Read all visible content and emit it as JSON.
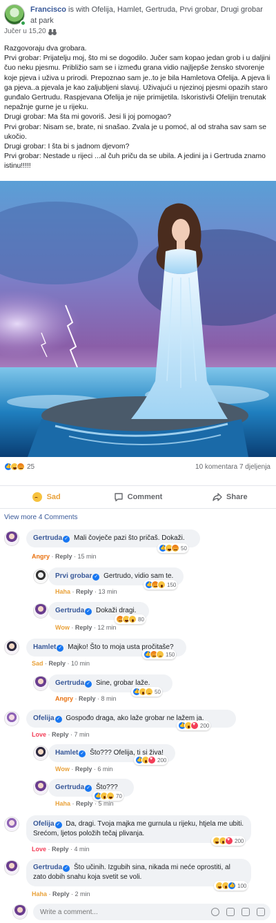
{
  "header": {
    "author": "Francisco",
    "with_text": "is with Ofelija, Hamlet, Gertruda, Prvi grobar, Drugi grobar at park",
    "time": "Jučer u 15,20",
    "audience_icon": "friends-icon"
  },
  "post": {
    "text": "Razgovoraju dva grobara.\nPrvi grobar: Prijatelju moj, što mi se dogodilo. Jučer sam kopao jedan grob i u daljini čuo neku pjesmu. Približio sam se i između grana vidio najljepše žensko stvorenje koje pjeva i uživa u prirodi. Prepoznao sam je..to je bila Hamletova Ofelija. A pjeva li ga pjeva..a pjevala je kao zaljubljeni slavuj. Uživajući u njezinoj pjesmi opazih staro gunđalo Gertrudu. Raspjevana Ofelija je nije primijetila. Iskoristivši Ofelijin trenutak nepažnje gurne je u rijeku.\nDrugi grobar: Ma šta mi govoriš. Jesi li joj pomogao?\nPrvi grobar: Nisam se, brate, ni snašao. Zvala je u pomoć, al od straha sav sam se ukočio.\nDrugi grobar: I šta bi s jadnom djevom?\nPrvi grobar: Nestade u rijeci ...al čuh priču da se ubila. A jedini ja i Gertruda znamo istinu!!!!!"
  },
  "stats": {
    "reactions": [
      "like",
      "haha",
      "angry"
    ],
    "count": "25",
    "comments_shares": "10 komentara 7 djeljenja"
  },
  "actions": {
    "sad": "Sad",
    "comment": "Comment",
    "share": "Share"
  },
  "view_more": "View more 4 Comments",
  "reply_label": "Reply",
  "comments": [
    {
      "name": "Gertruda",
      "text": "Mali čovječe pazi što pričaš. Dokaži.",
      "reaction": "Angry",
      "time": "15 min",
      "react_count": "50",
      "avatar": "gertruda"
    },
    {
      "name": "Prvi grobar",
      "text": "Gertrudo, vidio sam te.",
      "reaction": "Haha",
      "time": "13 min",
      "react_count": "150",
      "avatar": "prvi"
    },
    {
      "name": "Gertruda",
      "text": "Dokaži dragi.",
      "reaction": "Wow",
      "time": "12 min",
      "react_count": "80",
      "avatar": "gertruda"
    },
    {
      "name": "Hamlet",
      "text": "Majko! Što to moja usta pročitaše?",
      "reaction": "Sad",
      "time": "10 min",
      "react_count": "150",
      "avatar": "hamlet"
    },
    {
      "name": "Gertruda",
      "text": "Sine, grobar laže.",
      "reaction": "Angry",
      "time": "8 min",
      "react_count": "50",
      "avatar": "gertruda"
    },
    {
      "name": "Ofelija",
      "text": "Gospođo draga, ako laže grobar ne lažem ja.",
      "reaction": "Love",
      "time": "7 min",
      "react_count": "200",
      "avatar": "ofelija"
    },
    {
      "name": "Hamlet",
      "text": "Što??? Ofelija, ti si živa!",
      "reaction": "Wow",
      "time": "6 min",
      "react_count": "200",
      "avatar": "hamlet"
    },
    {
      "name": "Gertruda",
      "text": "Što???",
      "reaction": "Haha",
      "time": "5 min",
      "react_count": "70",
      "avatar": "gertruda"
    },
    {
      "name": "Ofelija",
      "text": "Da, dragi. Tvoja majka me gurnula u rijeku, htjela me ubiti. Srećom, ljetos položih tečaj plivanja.",
      "reaction": "Love",
      "time": "4 min",
      "react_count": "200",
      "avatar": "ofelija"
    },
    {
      "name": "Gertruda",
      "text": "Što učinih. Izgubih sina, nikada mi neće oprostiti, al zato dobih snahu koja svetit se voli.",
      "reaction": "Haha",
      "time": "2 min",
      "react_count": "100",
      "avatar": "gertruda"
    }
  ],
  "reaction_colors": {
    "Angry": "#e9710f",
    "Haha": "#e9a23b",
    "Wow": "#e9a23b",
    "Sad": "#e9a23b",
    "Love": "#f33e58"
  },
  "composer": {
    "placeholder": "Write a comment..."
  }
}
